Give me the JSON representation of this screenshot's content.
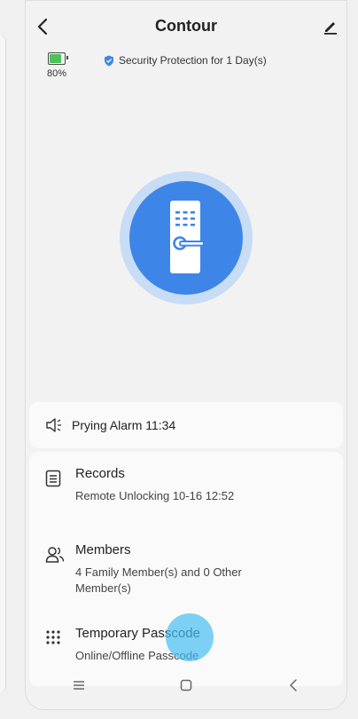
{
  "header": {
    "title": "Contour",
    "back_icon": "chevron-left-icon",
    "edit_icon": "pencil-icon"
  },
  "status": {
    "battery_percent": 80,
    "battery_label": "80%",
    "battery_color": "#4cc25a",
    "security_text": "Security Protection for 1 Day(s)",
    "shield_color": "#3d86e8"
  },
  "lock": {
    "icon": "door-lock-icon",
    "outer_color": "#c8dcf5",
    "inner_color": "#3d86e8"
  },
  "alarm": {
    "icon": "speaker-alarm-icon",
    "text": "Prying Alarm 11:34"
  },
  "items": [
    {
      "icon": "document-icon",
      "title": "Records",
      "subtitle": "Remote Unlocking 10-16 12:52"
    },
    {
      "icon": "people-icon",
      "title": "Members",
      "subtitle": "4 Family Member(s) and 0 Other Member(s)"
    },
    {
      "icon": "keypad-icon",
      "title": "Temporary Passcode",
      "subtitle": "Online/Offline Passcode"
    }
  ],
  "navbar": {
    "recent_icon": "menu-icon",
    "home_icon": "square-home-icon",
    "back_icon": "back-arrow-icon"
  }
}
